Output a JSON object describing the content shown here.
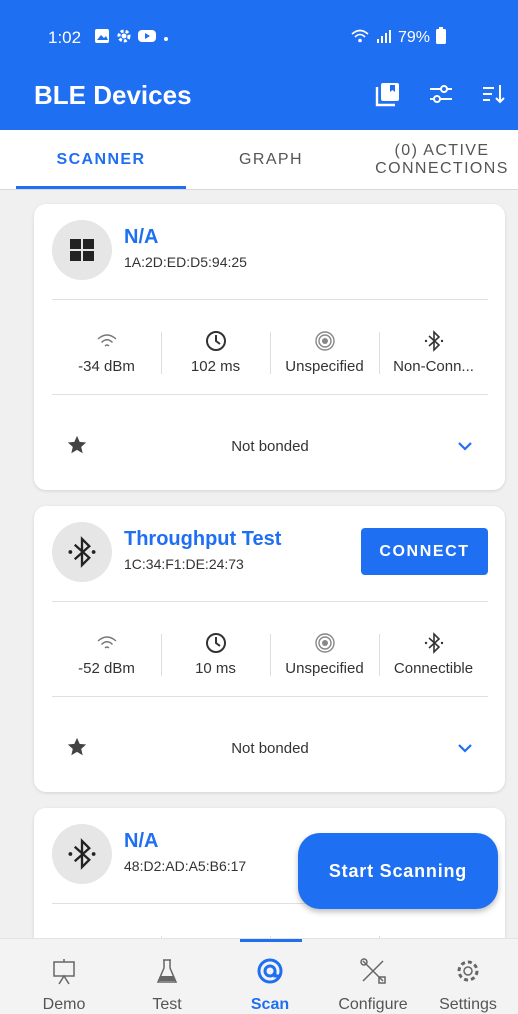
{
  "status_bar": {
    "time": "1:02",
    "battery": "79%",
    "icons": [
      "image-icon",
      "gear-icon",
      "youtube-icon",
      "dot-icon",
      "wifi-icon",
      "signal-icon",
      "battery-icon"
    ]
  },
  "app_bar": {
    "title": "BLE Devices",
    "actions": [
      "bookmark-icon",
      "filter-icon",
      "sort-icon"
    ]
  },
  "tabs": [
    {
      "label": "SCANNER",
      "active": true
    },
    {
      "label": "GRAPH",
      "active": false
    },
    {
      "label": "(0) ACTIVE CONNECTIONS",
      "active": false
    }
  ],
  "devices": [
    {
      "name": "N/A",
      "address": "1A:2D:ED:D5:94:25",
      "icon": "windows-icon",
      "rssi": "-34 dBm",
      "interval": "102 ms",
      "beacon": "Unspecified",
      "connectable": "Non-Conn...",
      "bond": "Not bonded"
    },
    {
      "name": "Throughput Test",
      "address": "1C:34:F1:DE:24:73",
      "icon": "bluetooth-icon",
      "connect_label": "CONNECT",
      "rssi": "-52 dBm",
      "interval": "10 ms",
      "beacon": "Unspecified",
      "connectable": "Connectible",
      "bond": "Not bonded"
    },
    {
      "name": "N/A",
      "address": "48:D2:AD:A5:B6:17",
      "icon": "bluetooth-icon"
    }
  ],
  "fab": {
    "label": "Start Scanning"
  },
  "bottom_nav": [
    {
      "label": "Demo",
      "icon": "presentation-icon",
      "active": false
    },
    {
      "label": "Test",
      "icon": "flask-icon",
      "active": false
    },
    {
      "label": "Scan",
      "icon": "scan-icon",
      "active": true
    },
    {
      "label": "Configure",
      "icon": "tools-icon",
      "active": false
    },
    {
      "label": "Settings",
      "icon": "gear-icon",
      "active": false
    }
  ],
  "colors": {
    "primary": "#1f6ff2",
    "background": "#f0f0f0",
    "card": "#ffffff"
  }
}
